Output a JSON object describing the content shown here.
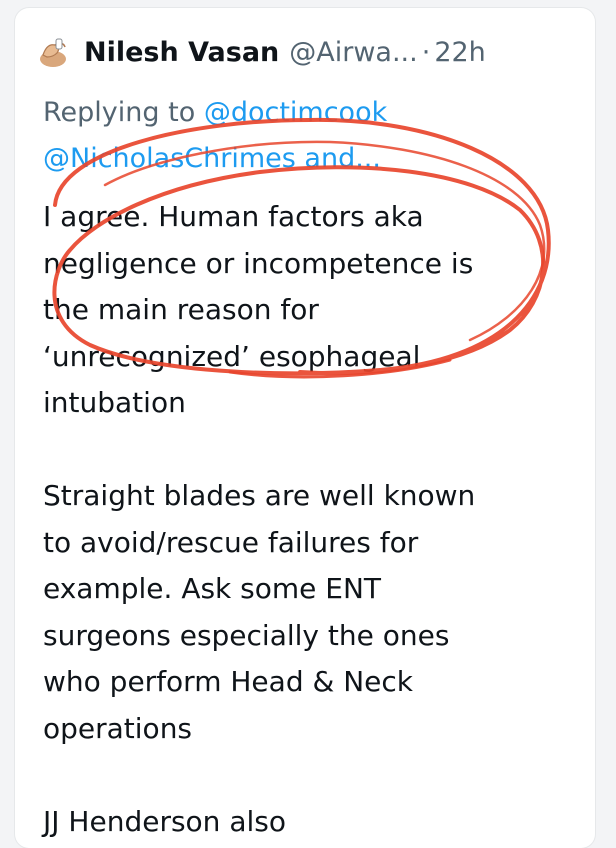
{
  "tweet": {
    "author_name": "Nilesh Vasan",
    "author_handle": "@Airwa...",
    "separator": "·",
    "timestamp": "22h",
    "avatar_icon": "hand-emoji-avatar",
    "replying_prefix": "Replying to",
    "replying_mention_1": "@doctimcook",
    "replying_mention_2": "@NicholasChrimes and...",
    "body_lines": [
      "I agree. Human factors aka",
      "negligence or incompetence is",
      "the main reason for",
      "‘unrecognized’ esophageal",
      "intubation",
      "Straight blades are well known",
      "to avoid/rescue failures for",
      "example. Ask some ENT",
      "surgeons especially the ones",
      "who perform Head & Neck",
      "operations",
      "JJ Henderson also"
    ]
  },
  "colors": {
    "link": "#1d9bf0",
    "secondary_text": "#536471",
    "primary_text": "#0f1419",
    "annotation_ink": "#e8452c"
  }
}
